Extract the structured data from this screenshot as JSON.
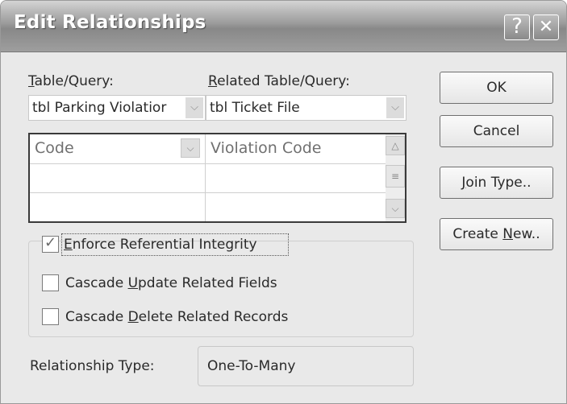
{
  "dialog": {
    "title": "Edit Relationships",
    "help_button": "?",
    "close_button": "✕"
  },
  "table_query": {
    "label": "Table/Query:",
    "label_accel": "T",
    "label_rest": "able/Query:",
    "value": "tbl Parking Violatior"
  },
  "related_table_query": {
    "label": "Related Table/Query:",
    "label_accel": "R",
    "label_rest": "elated Table/Query:",
    "value": "tbl Ticket File"
  },
  "field_grid": {
    "rows": [
      {
        "left": "Code",
        "right": "Violation Code"
      },
      {
        "left": "",
        "right": ""
      },
      {
        "left": "",
        "right": ""
      }
    ]
  },
  "buttons": {
    "ok": "OK",
    "cancel": "Cancel",
    "join_type_accel": "J",
    "join_type_rest": "oin Type..",
    "create_new_pre": "Create ",
    "create_new_accel": "N",
    "create_new_rest": "ew.."
  },
  "options": {
    "enforce": {
      "accel": "E",
      "rest": "nforce Referential Integrity",
      "checked": true
    },
    "cascade_update": {
      "pre": "Cascade ",
      "accel": "U",
      "rest": "pdate Related Fields",
      "checked": false
    },
    "cascade_delete": {
      "pre": "Cascade ",
      "accel": "D",
      "rest": "elete Related Records",
      "checked": false
    }
  },
  "relationship_type": {
    "label": "Relationship Type:",
    "value": "One-To-Many"
  },
  "icons": {
    "dropdown": "chevron-down-icon",
    "scroll_up": "chevron-up-icon",
    "scroll_down": "chevron-down-icon",
    "scroll_thumb": "scroll-thumb-icon"
  }
}
